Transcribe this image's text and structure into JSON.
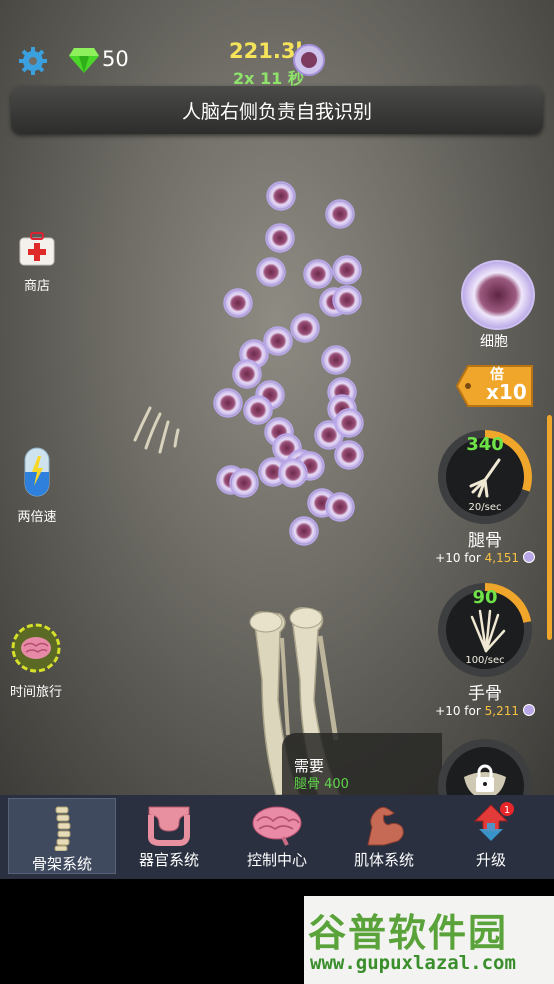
{
  "header": {
    "gems": "50",
    "cells": "221.3k",
    "rate": "2x 11 秒",
    "fact_banner": "人脑右侧负责自我识别"
  },
  "left_buttons": [
    {
      "label": "商店",
      "icon": "first-aid-kit-icon"
    },
    {
      "label": "两倍速",
      "icon": "pill-icon"
    },
    {
      "label": "时间旅行",
      "icon": "brain-clock-icon"
    }
  ],
  "right_panel": {
    "cell_label": "细胞",
    "multiplier_top": "倍",
    "multiplier": "x10",
    "upgrades": [
      {
        "level": "340",
        "per_sec": "20/sec",
        "name": "腿骨",
        "cost_prefix": "+10 for ",
        "cost": "4,151",
        "progress": 0.3,
        "icon": "leg-bone-icon"
      },
      {
        "level": "90",
        "per_sec": "100/sec",
        "name": "手骨",
        "cost_prefix": "+10 for ",
        "cost": "5,211",
        "progress": 0.22,
        "icon": "hand-bone-icon"
      }
    ],
    "locked_icon": "lock-icon"
  },
  "need": {
    "title": "需要",
    "requirement": "腿骨 400"
  },
  "nav": [
    {
      "label": "骨架系统",
      "icon": "spine-icon",
      "active": true
    },
    {
      "label": "器官系统",
      "icon": "intestine-icon",
      "active": false
    },
    {
      "label": "控制中心",
      "icon": "brain-icon",
      "active": false
    },
    {
      "label": "肌体系统",
      "icon": "muscle-arm-icon",
      "active": false
    },
    {
      "label": "升级",
      "icon": "upgrade-arrow-icon",
      "active": false,
      "badge": "1"
    }
  ],
  "watermark": {
    "title": "谷普软件园",
    "url": "www.gupuxlazal.com"
  },
  "colors": {
    "accent_yellow": "#f5e35a",
    "green": "#6fe247",
    "orange": "#f0a62a",
    "nav_bg": "#2a3040"
  }
}
